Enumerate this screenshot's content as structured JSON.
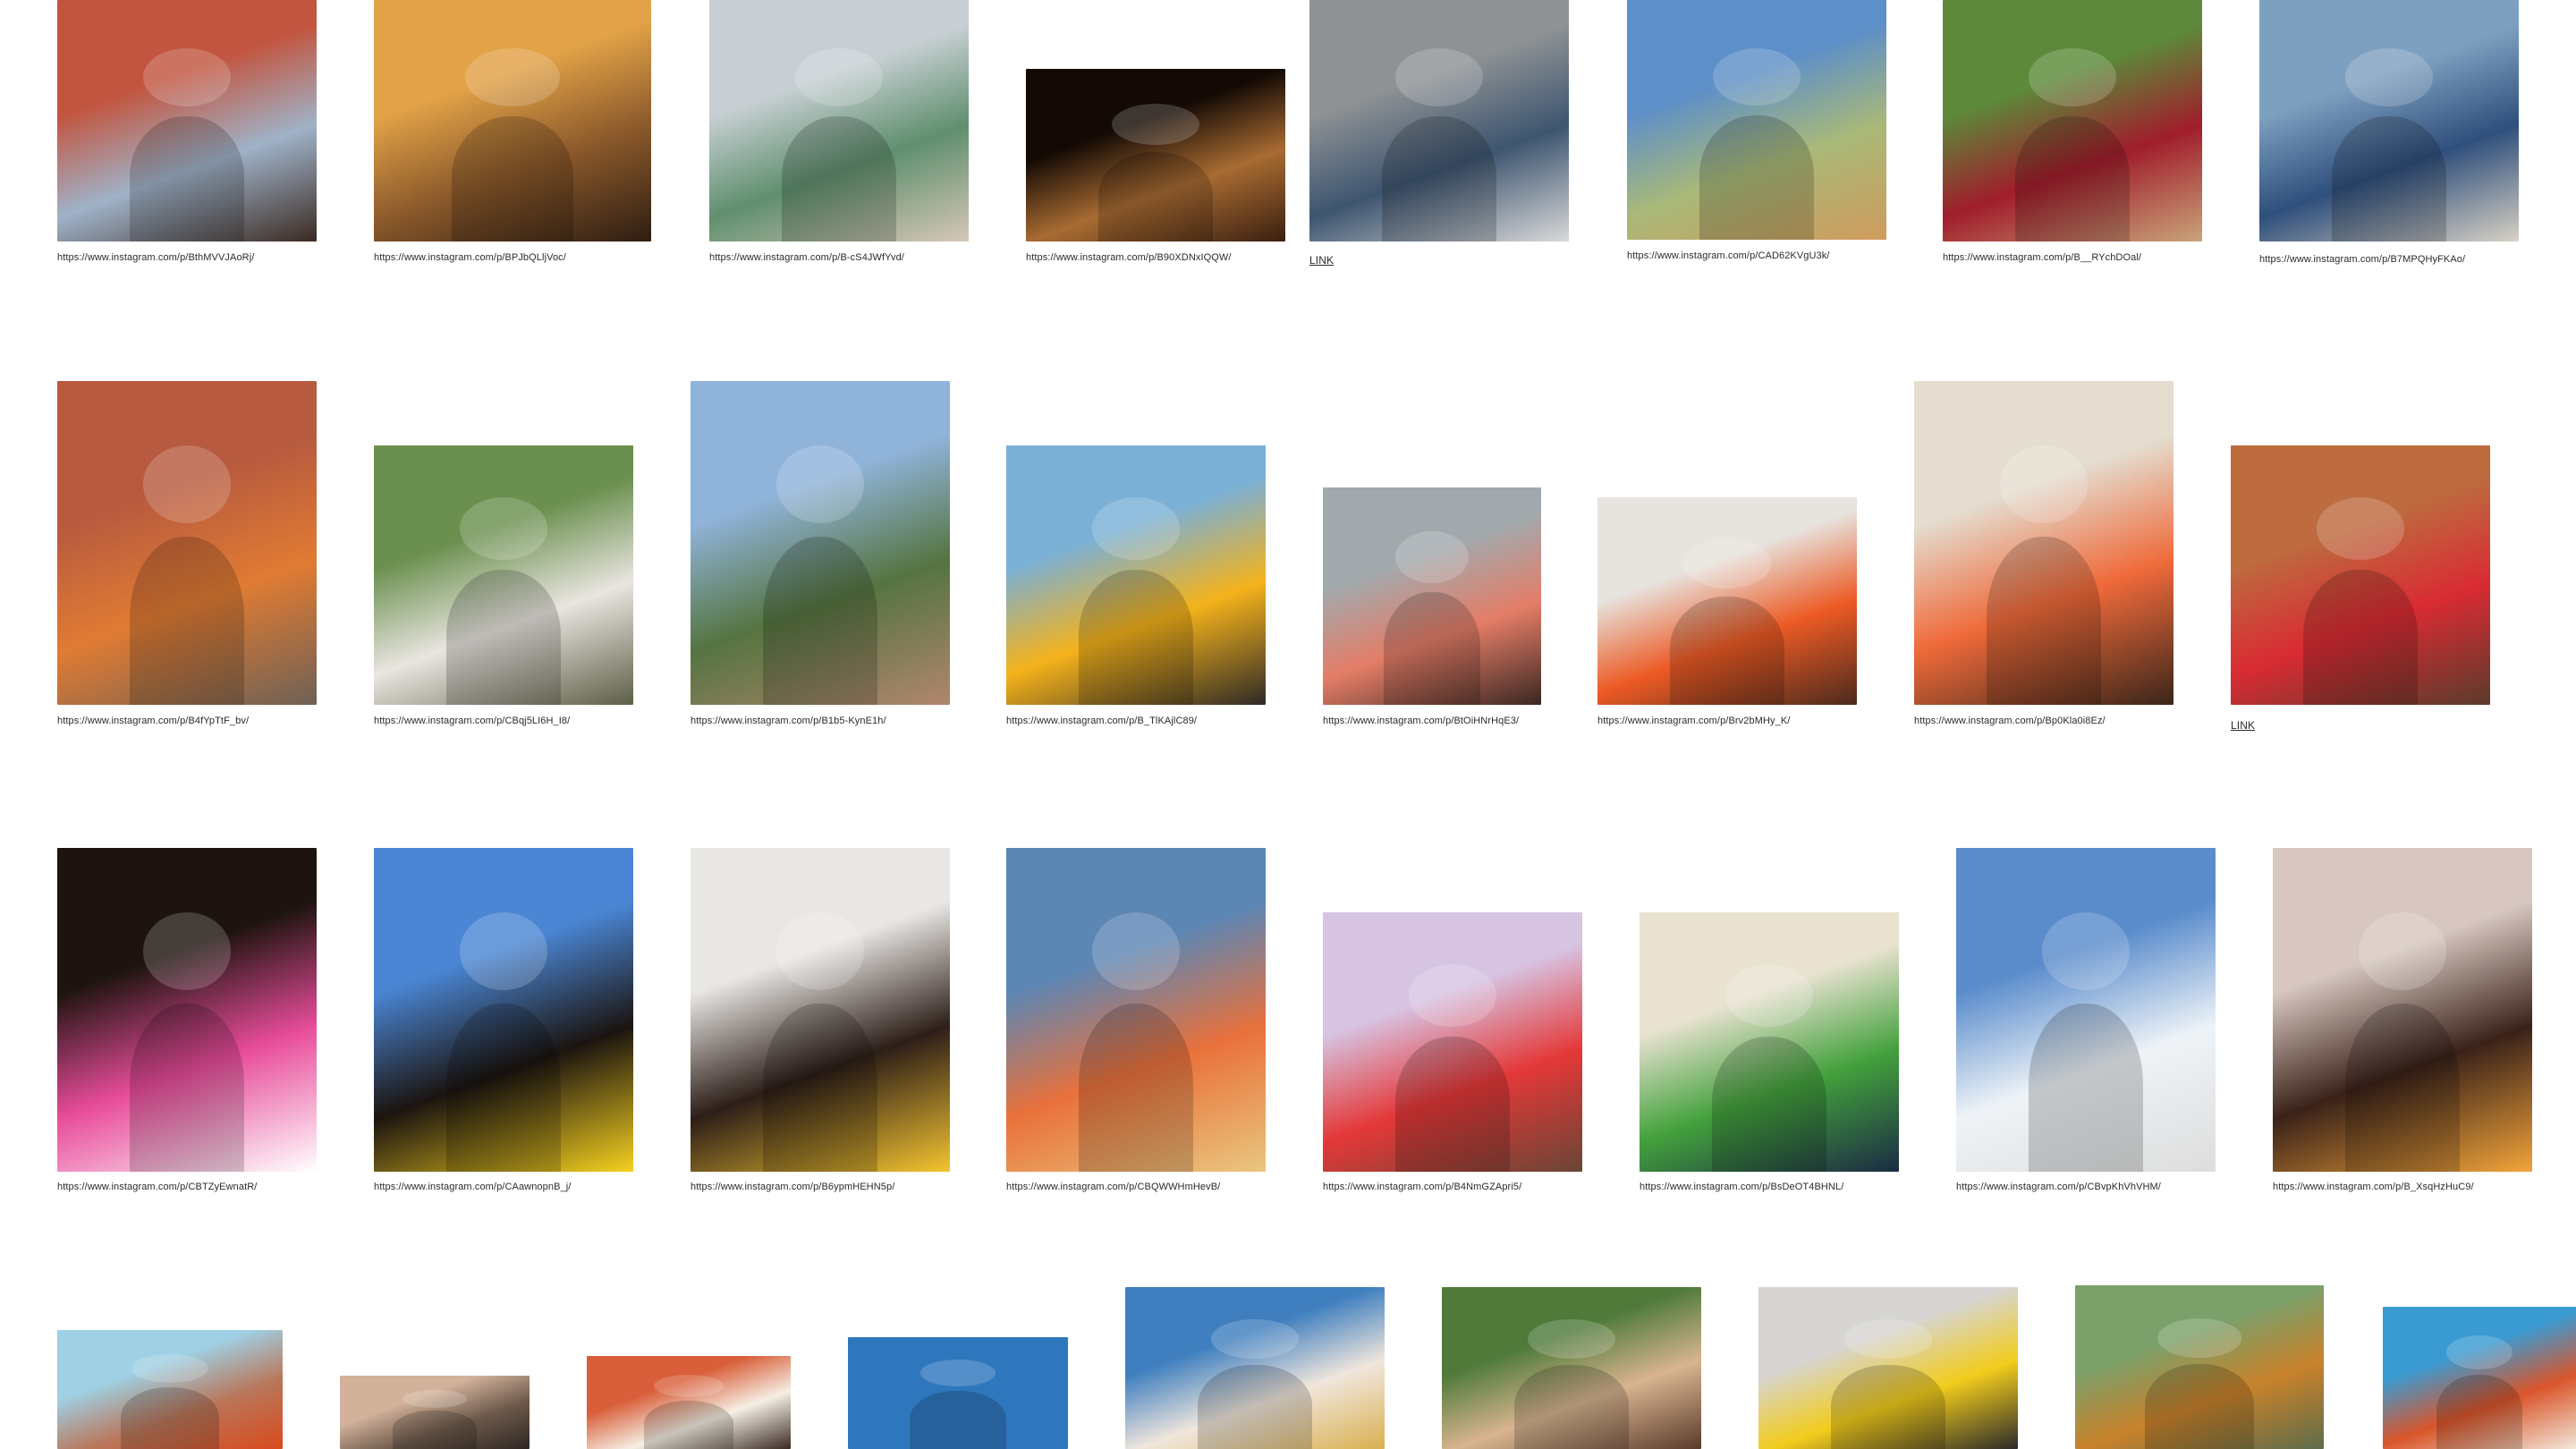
{
  "gallery": {
    "rows": [
      [
        {
          "caption": "https://www.instagram.com/p/BthMVVJAoRj/",
          "palette": [
            "#c2553f",
            "#9fb2c8",
            "#3b2a22"
          ],
          "subject": "woman in denim jacket portrait"
        },
        {
          "caption": "https://www.instagram.com/p/BPJbQLljVoc/",
          "palette": [
            "#e2a247",
            "#8c5a2b",
            "#2e1d12"
          ],
          "subject": "woman in striped top sitting"
        },
        {
          "caption": "https://www.instagram.com/p/B-cS4JWfYvd/",
          "palette": [
            "#c7cfd3",
            "#5f8f6e",
            "#d6c7b7"
          ],
          "subject": "woman in floral suit by car"
        },
        {
          "caption": "https://www.instagram.com/p/B90XDNxIQQW/",
          "palette": [
            "#140a05",
            "#a86b32",
            "#3a1f10"
          ],
          "subject": "portrait in dark light"
        },
        {
          "caption": "LINK",
          "link": true,
          "palette": [
            "#8e9294",
            "#3e5570",
            "#d9d9d9"
          ],
          "subject": "roller skaters"
        },
        {
          "caption": "https://www.instagram.com/p/CAD62KVgU3k/",
          "palette": [
            "#5d8fc8",
            "#a9b978",
            "#cf9b5d"
          ],
          "subject": "woman in green dress"
        },
        {
          "caption": "https://www.instagram.com/p/B__RYchDOal/",
          "palette": [
            "#5c8a3a",
            "#a01d2b",
            "#c9a47a"
          ],
          "subject": "woman in red dress in hammock"
        },
        {
          "caption": "https://www.instagram.com/p/B7MPQHyFKAo/",
          "palette": [
            "#7ea0c0",
            "#2f4f7c",
            "#d8d1c4"
          ],
          "subject": "woman on sofa with dog"
        }
      ],
      [
        {
          "caption": "https://www.instagram.com/p/B4fYpTtF_bv/",
          "palette": [
            "#b75a3f",
            "#e07b33",
            "#6e6155"
          ],
          "subject": "two women on street"
        },
        {
          "caption": "https://www.instagram.com/p/CBqj5LI6H_I8/",
          "palette": [
            "#6a8f4e",
            "#e9e5e0",
            "#5d5e46"
          ],
          "subject": "woman by hedge"
        },
        {
          "caption": "https://www.instagram.com/p/B1b5-KynE1h/",
          "palette": [
            "#8fb3d9",
            "#557440",
            "#b1866e"
          ],
          "subject": "woman on canal path"
        },
        {
          "caption": "https://www.instagram.com/p/B_TlKAjlC89/",
          "palette": [
            "#7ab0d6",
            "#f4b21b",
            "#2e2a26"
          ],
          "subject": "woman with tulips"
        },
        {
          "caption": "https://www.instagram.com/p/BtOiHNrHqE3/",
          "palette": [
            "#a2a9ad",
            "#e47d67",
            "#3a2722"
          ],
          "subject": "portrait in shadow"
        },
        {
          "caption": "https://www.instagram.com/p/Brv2bMHy_K/",
          "palette": [
            "#e7e3de",
            "#ec5a24",
            "#4b2a1d"
          ],
          "subject": "woman with orange headscarf"
        },
        {
          "caption": "https://www.instagram.com/p/Bp0Kla0i8Ez/",
          "palette": [
            "#e4ddd0",
            "#ef6a3a",
            "#3a2519"
          ],
          "subject": "woman with orange bow"
        },
        {
          "caption": "LINK",
          "link": true,
          "palette": [
            "#bd6b3f",
            "#d92b33",
            "#5a3b2b"
          ],
          "subject": "two women in red bikinis"
        }
      ],
      [
        {
          "caption": "https://www.instagram.com/p/CBTZyEwnatR/",
          "palette": [
            "#1e140f",
            "#e84c9a",
            "#ffffff"
          ],
          "subject": "afro with rainbow eye makeup"
        },
        {
          "caption": "https://www.instagram.com/p/CAawnopnB_j/",
          "palette": [
            "#4a86d4",
            "#1b1410",
            "#f6d11f"
          ],
          "subject": "afro with smiley stickers"
        },
        {
          "caption": "https://www.instagram.com/p/B6ypmHEHN5p/",
          "palette": [
            "#e9e7e4",
            "#2d1e18",
            "#f4c430"
          ],
          "subject": "woman with smiley makeup"
        },
        {
          "caption": "https://www.instagram.com/p/CBQWWHmHevB/",
          "palette": [
            "#5c86b4",
            "#e9713b",
            "#e9c77f"
          ],
          "subject": "parachute on beach"
        },
        {
          "caption": "https://www.instagram.com/p/B4NmGZApri5/",
          "palette": [
            "#d7c4e3",
            "#e43838",
            "#6a4535"
          ],
          "subject": "woman with heart sunglasses"
        },
        {
          "caption": "https://www.instagram.com/p/BsDeOT4BHNL/",
          "palette": [
            "#e9e2d1",
            "#43a13c",
            "#1b2b44"
          ],
          "subject": "woman with apple on head"
        },
        {
          "caption": "https://www.instagram.com/p/CBvpKhVhVHM/",
          "palette": [
            "#5a8ccc",
            "#eef3f7",
            "#dddddd"
          ],
          "subject": "man jumping against sky"
        },
        {
          "caption": "https://www.instagram.com/p/B_XsqHzHuC9/",
          "palette": [
            "#d7c7c0",
            "#3a2219",
            "#f2a43a"
          ],
          "subject": "woman with orange eyeshadow"
        }
      ],
      [
        {
          "caption": "",
          "palette": [
            "#9fd0e3",
            "#b9765a",
            "#d94a1c"
          ],
          "subject": "beach scene"
        },
        {
          "caption": "",
          "palette": [
            "#d2b29a",
            "#6e5a4c",
            "#2f2622"
          ],
          "subject": "street lamp"
        },
        {
          "caption": "",
          "palette": [
            "#d95f3a",
            "#f5efe4",
            "#3a2a22"
          ],
          "subject": "striped awning"
        },
        {
          "caption": "",
          "palette": [
            "#2f77bd",
            "#2f77bd",
            "#2f77bd"
          ],
          "subject": "blue"
        },
        {
          "caption": "",
          "palette": [
            "#3f7fbf",
            "#f0e6dc",
            "#d9b04f"
          ],
          "subject": "woman with face gems"
        },
        {
          "caption": "",
          "palette": [
            "#4f7a3a",
            "#d8b48f",
            "#5a3a2b"
          ],
          "subject": "woman in greenery"
        },
        {
          "caption": "",
          "palette": [
            "#d6d5d3",
            "#f2cc1c",
            "#2a2a2a"
          ],
          "subject": "yellow sunglasses close-up"
        },
        {
          "caption": "",
          "palette": [
            "#7ba06a",
            "#c8822b",
            "#5d6c4a"
          ],
          "subject": "man in field"
        },
        {
          "caption": "",
          "palette": [
            "#3a9bd3",
            "#d9552a",
            "#f2e7da"
          ],
          "subject": "person on blue background"
        }
      ]
    ]
  }
}
